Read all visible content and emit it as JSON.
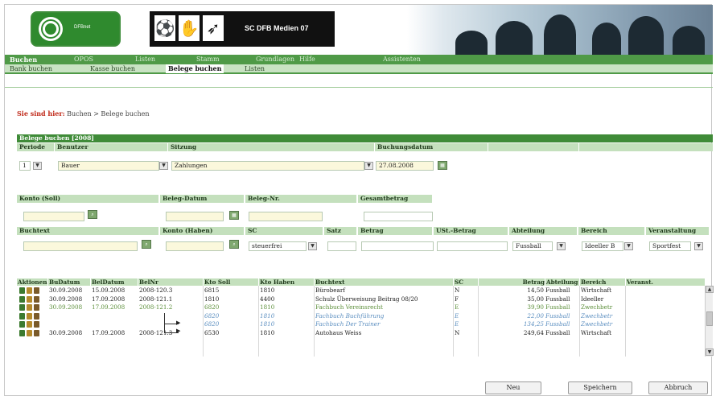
{
  "header": {
    "logo_text": "DFBnet",
    "club_name": "SC DFB Medien 07",
    "pictograms": [
      "football-player-icon",
      "handball-player-icon",
      "runner-icon"
    ]
  },
  "nav": {
    "items": [
      {
        "label": "Buchen",
        "active": true
      },
      {
        "label": "OPOS",
        "active": false
      },
      {
        "label": "Listen",
        "active": false
      },
      {
        "label": "Stamm",
        "active": false
      },
      {
        "label": "Grundlagen",
        "active": false
      },
      {
        "label": "Hilfe",
        "active": false
      },
      {
        "label": "Assistenten",
        "active": false
      }
    ]
  },
  "subnav": {
    "items": [
      {
        "label": "Bank buchen",
        "active": false
      },
      {
        "label": "Kasse buchen",
        "active": false
      },
      {
        "label": "Belege buchen",
        "active": true
      },
      {
        "label": "Listen",
        "active": false
      }
    ]
  },
  "breadcrumb": {
    "prefix": "Sie sind hier:",
    "path": "Buchen > Belege buchen"
  },
  "panel": {
    "title": "Belege buchen [2008]"
  },
  "form": {
    "periode_label": "Periode",
    "periode_value": "1",
    "benutzer_label": "Benutzer",
    "benutzer_value": "Bauer",
    "sitzung_label": "Sitzung",
    "sitzung_value": "Zahlungen",
    "buchungsdatum_label": "Buchungsdatum",
    "buchungsdatum_value": "27.08.2008",
    "konto_soll_label": "Konto (Soll)",
    "beleg_datum_label": "Beleg-Datum",
    "beleg_nr_label": "Beleg-Nr.",
    "gesamtbetrag_label": "Gesamtbetrag",
    "buchtext_label": "Buchtext",
    "konto_haben_label": "Konto (Haben)",
    "sc_label": "SC",
    "sc_value": "steuerfrei",
    "satz_label": "Satz",
    "betrag_label": "Betrag",
    "ust_betrag_label": "USt.-Betrag",
    "abteilung_label": "Abteilung",
    "abteilung_value": "Fussball",
    "bereich_label": "Bereich",
    "bereich_value": "Ideeller B",
    "veranstaltung_label": "Veranstaltung",
    "veranstaltung_value": "Sportfest"
  },
  "grid": {
    "headers": [
      "Aktionen",
      "BuDatum",
      "BelDatum",
      "BelNr",
      "Kto Soll",
      "Kto Haben",
      "Buchtext",
      "SC",
      "Betrag",
      "Abteilung",
      "Bereich",
      "Veranst."
    ],
    "rows": [
      {
        "budatum": "30.09.2008",
        "beldatum": "15.09.2008",
        "belnr": "2008-120.3",
        "soll": "6815",
        "haben": "1810",
        "text": "Bürobearf",
        "sc": "N",
        "betrag": "14,50",
        "abteilung": "Fussball",
        "bereich": "Wirtschaft",
        "style": "normal",
        "split": false
      },
      {
        "budatum": "30.09.2008",
        "beldatum": "17.09.2008",
        "belnr": "2008-121.1",
        "soll": "1810",
        "haben": "4400",
        "text": "Schulz Überweisung Beitrag 08/20",
        "sc": "F",
        "betrag": "35,00",
        "abteilung": "Fussball",
        "bereich": "Ideeller",
        "style": "normal",
        "split": false
      },
      {
        "budatum": "30.09.2008",
        "beldatum": "17.09.2008",
        "belnr": "2008-121.2",
        "soll": "6820",
        "haben": "1810",
        "text": "Fachbuch Vereinsrecht",
        "sc": "E",
        "betrag": "39,90",
        "abteilung": "Fussball",
        "bereich": "Zwechbetr",
        "style": "green",
        "split": false
      },
      {
        "budatum": "",
        "beldatum": "",
        "belnr": "",
        "soll": "6820",
        "haben": "1810",
        "text": "Fachbuch Buchführung",
        "sc": "E",
        "betrag": "22,00",
        "abteilung": "Fussball",
        "bereich": "Zwechbetr",
        "style": "italic",
        "split": true
      },
      {
        "budatum": "",
        "beldatum": "",
        "belnr": "",
        "soll": "6820",
        "haben": "1810",
        "text": "Fachbuch Der Trainer",
        "sc": "E",
        "betrag": "134,25",
        "abteilung": "Fussball",
        "bereich": "Zwechbetr",
        "style": "italic",
        "split": true
      },
      {
        "budatum": "30.09.2008",
        "beldatum": "17.09.2008",
        "belnr": "2008-121.3",
        "soll": "6530",
        "haben": "1810",
        "text": "Autohaus Weiss",
        "sc": "N",
        "betrag": "249,64",
        "abteilung": "Fussball",
        "bereich": "Wirtschaft",
        "style": "normal",
        "split": false
      }
    ]
  },
  "buttons": {
    "neu": "Neu",
    "speichern": "Speichern",
    "abbruch": "Abbruch"
  },
  "colors": {
    "nav_green": "#4f9a47",
    "panel_green": "#3f8b38",
    "label_green": "#c4e0bd",
    "field_yellow": "#fbf8dc",
    "breadcrumb_red": "#c02a1a"
  }
}
